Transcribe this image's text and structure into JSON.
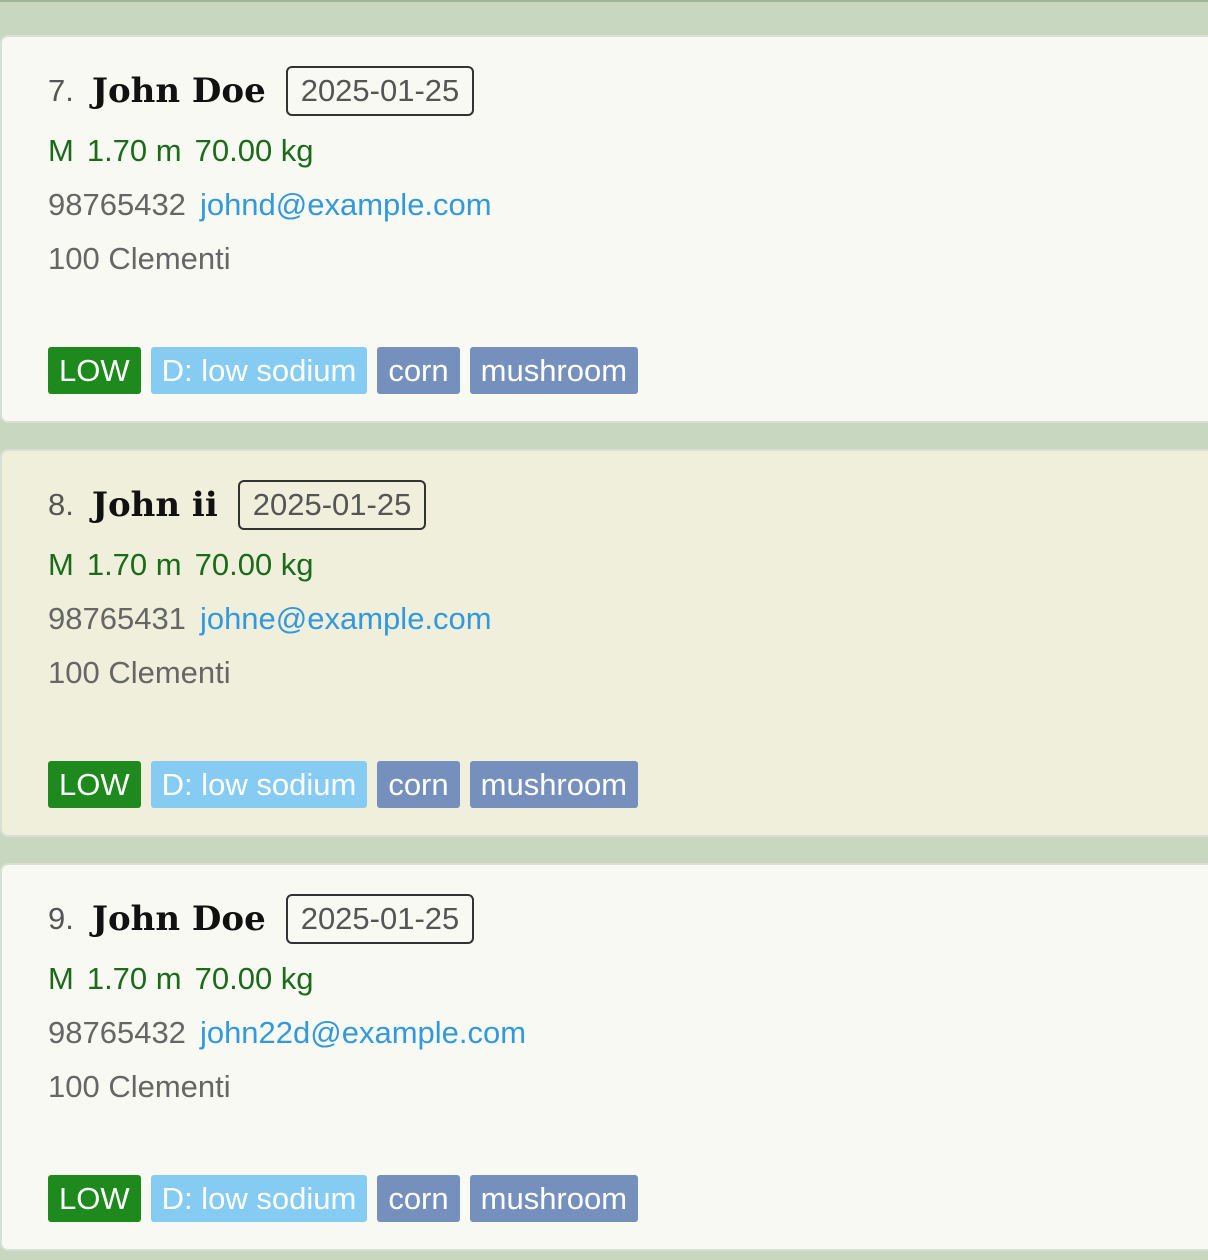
{
  "colors": {
    "background": "#c8d8c0",
    "card_light": "#f9f9f3",
    "card_selected": "#f0efdc",
    "stats_green": "#1b6b1b",
    "email_blue": "#3399dd",
    "level_tag": "#1e8a1e",
    "diet_tag": "#86ccf2",
    "allergy_tag": "#7590bd"
  },
  "persons": [
    {
      "index": "7.",
      "name": "John Doe",
      "date": "2025-01-25",
      "gender": "M",
      "height": "1.70 m",
      "weight": "70.00 kg",
      "phone": "98765432",
      "email": "johnd@example.com",
      "address": "100 Clementi",
      "tags": {
        "level": "LOW",
        "diet": "D: low sodium",
        "allergies": [
          "corn",
          "mushroom"
        ]
      },
      "selected": false
    },
    {
      "index": "8.",
      "name": "John ii",
      "date": "2025-01-25",
      "gender": "M",
      "height": "1.70 m",
      "weight": "70.00 kg",
      "phone": "98765431",
      "email": "johne@example.com",
      "address": "100 Clementi",
      "tags": {
        "level": "LOW",
        "diet": "D: low sodium",
        "allergies": [
          "corn",
          "mushroom"
        ]
      },
      "selected": true
    },
    {
      "index": "9.",
      "name": "John Doe",
      "date": "2025-01-25",
      "gender": "M",
      "height": "1.70 m",
      "weight": "70.00 kg",
      "phone": "98765432",
      "email": "john22d@example.com",
      "address": "100 Clementi",
      "tags": {
        "level": "LOW",
        "diet": "D: low sodium",
        "allergies": [
          "corn",
          "mushroom"
        ]
      },
      "selected": false
    }
  ]
}
